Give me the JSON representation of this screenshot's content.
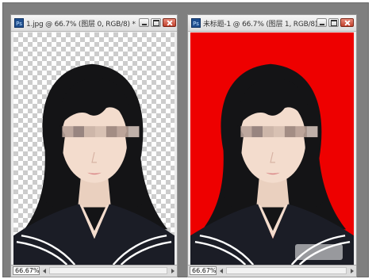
{
  "windows": [
    {
      "icon": "Ps",
      "title": "1.jpg @ 66.7% (图层 0, RGB/8) *",
      "zoom": "66.67%",
      "background": "transparent-checker"
    },
    {
      "icon": "Ps",
      "title": "未标题-1 @ 66.7% (图层 1, RGB/8) *",
      "zoom": "66.67%",
      "background": "red",
      "background_color": "#ee0000"
    }
  ],
  "colors": {
    "workspace": "#7f7f7f",
    "hair": "#141416",
    "skin": "#f3dccd",
    "uniform": "#1b1d26",
    "collar_stripe": "#ffffff",
    "red_background": "#ee0000"
  },
  "icons": [
    "photoshop-document-icon",
    "minimize-icon",
    "restore-icon",
    "close-icon",
    "scroll-left-arrow-icon",
    "scroll-right-arrow-icon"
  ]
}
